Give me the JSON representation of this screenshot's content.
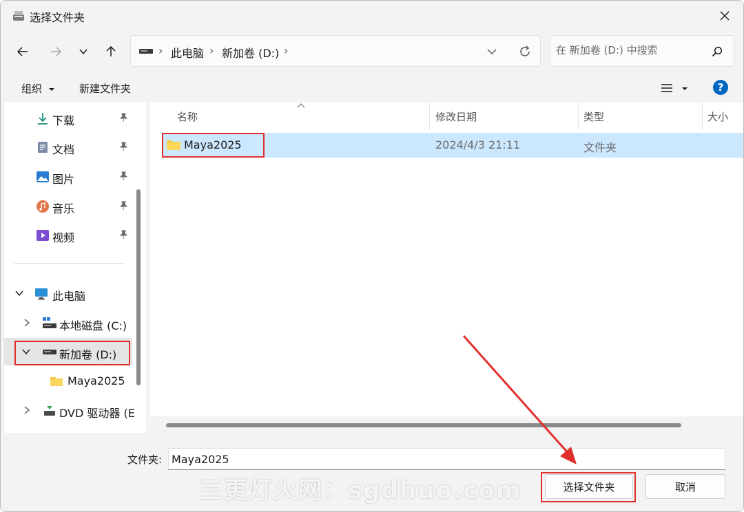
{
  "window": {
    "title": "选择文件夹",
    "accent": "#0067c0",
    "highlight": "#e0302e"
  },
  "address": {
    "crumbs": [
      "此电脑",
      "新加卷 (D:)"
    ],
    "separator": "›",
    "search_placeholder": "在 新加卷 (D:) 中搜索"
  },
  "toolbar": {
    "organize_label": "组织",
    "new_folder_label": "新建文件夹",
    "help_label": "?"
  },
  "sidebar": {
    "quick_access": [
      {
        "label": "下载",
        "icon": "download-icon"
      },
      {
        "label": "文档",
        "icon": "document-icon"
      },
      {
        "label": "图片",
        "icon": "picture-icon"
      },
      {
        "label": "音乐",
        "icon": "music-icon"
      },
      {
        "label": "视频",
        "icon": "video-icon"
      }
    ],
    "this_pc": "此电脑",
    "drives": [
      {
        "label": "本地磁盘 (C:)",
        "icon": "drive-icon"
      },
      {
        "label": "新加卷 (D:)",
        "icon": "drive-icon"
      },
      {
        "label": "Maya2025",
        "icon": "folder-icon"
      },
      {
        "label": "DVD 驱动器 (E",
        "icon": "dvd-icon"
      }
    ]
  },
  "file_list": {
    "columns": [
      "名称",
      "修改日期",
      "类型",
      "大小"
    ],
    "rows": [
      {
        "name": "Maya2025",
        "modified": "2024/4/3 21:11",
        "type": "文件夹",
        "size": ""
      }
    ]
  },
  "footer": {
    "folder_label": "文件夹:",
    "folder_value": "Maya2025",
    "select_button": "选择文件夹",
    "cancel_button": "取消"
  },
  "watermark": "三更灯火网：sgdhuo.com"
}
